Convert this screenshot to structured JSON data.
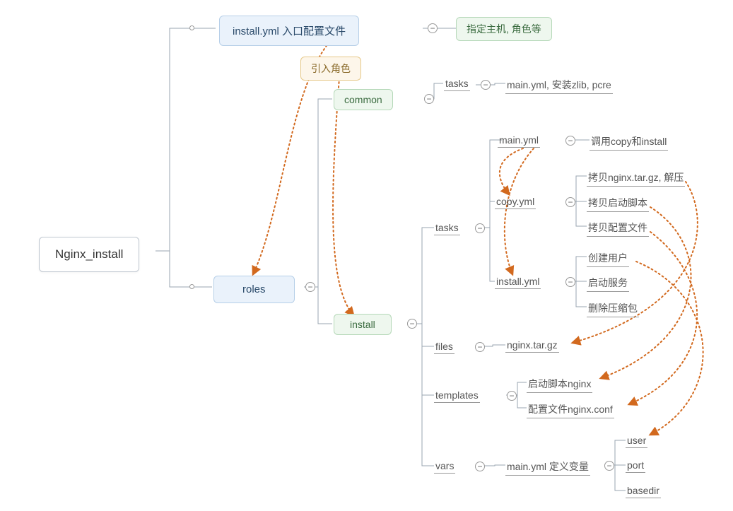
{
  "root": {
    "label": "Nginx_install"
  },
  "install_yml": {
    "label": "install.yml 入口配置文件",
    "note": "指定主机, 角色等"
  },
  "import_role": {
    "label": "引入角色"
  },
  "roles": {
    "label": "roles"
  },
  "common": {
    "label": "common",
    "tasks_label": "tasks",
    "tasks_content": "main.yml, 安装zlib, pcre"
  },
  "install": {
    "label": "install",
    "tasks": {
      "label": "tasks",
      "main_yml": {
        "label": "main.yml",
        "note": "调用copy和install"
      },
      "copy_yml": {
        "label": "copy.yml",
        "items": [
          "拷贝nginx.tar.gz, 解压",
          "拷贝启动脚本",
          "拷贝配置文件"
        ]
      },
      "install_yml": {
        "label": "install.yml",
        "items": [
          "创建用户",
          "启动服务",
          "删除压缩包"
        ]
      }
    },
    "files": {
      "label": "files",
      "content": "nginx.tar.gz"
    },
    "templates": {
      "label": "templates",
      "items": [
        "启动脚本nginx",
        "配置文件nginx.conf"
      ]
    },
    "vars": {
      "label": "vars",
      "main_yml": "main.yml 定义变量",
      "items": [
        "user",
        "port",
        "basedir"
      ]
    }
  },
  "minus": "−"
}
